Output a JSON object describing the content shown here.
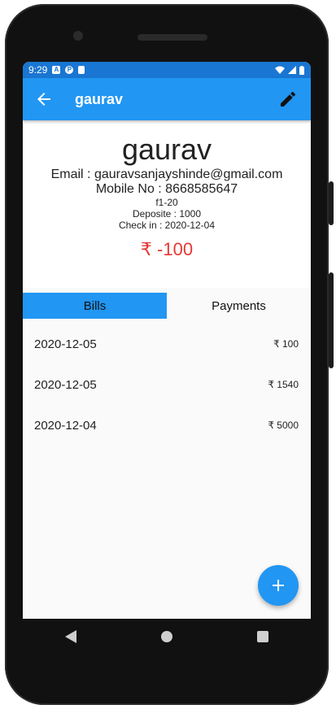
{
  "status_bar": {
    "time": "9:29",
    "icons": [
      "a-notification-icon",
      "p-notification-icon",
      "sim-icon"
    ],
    "right_icons": [
      "wifi-icon",
      "signal-icon",
      "battery-icon"
    ]
  },
  "app_bar": {
    "title": "gaurav",
    "color": "#2196f3"
  },
  "profile": {
    "name": "gaurav",
    "email": "Email : gauravsanjayshinde@gmail.com",
    "mobile": "Mobile No : 8668585647",
    "room": "f1-20",
    "deposit": "Deposite : 1000",
    "check_in": "Check in : 2020-12-04",
    "balance": "₹ -100",
    "balance_color": "#e53935"
  },
  "tabs": [
    {
      "label": "Bills",
      "active": true
    },
    {
      "label": "Payments",
      "active": false
    }
  ],
  "bills": [
    {
      "date": "2020-12-05",
      "amount": "₹ 100"
    },
    {
      "date": "2020-12-05",
      "amount": "₹ 1540"
    },
    {
      "date": "2020-12-04",
      "amount": "₹ 5000"
    }
  ],
  "fab": {
    "icon": "plus-icon"
  },
  "nav_bar": {
    "icons": [
      "back-triangle-icon",
      "home-circle-icon",
      "recents-square-icon"
    ]
  }
}
